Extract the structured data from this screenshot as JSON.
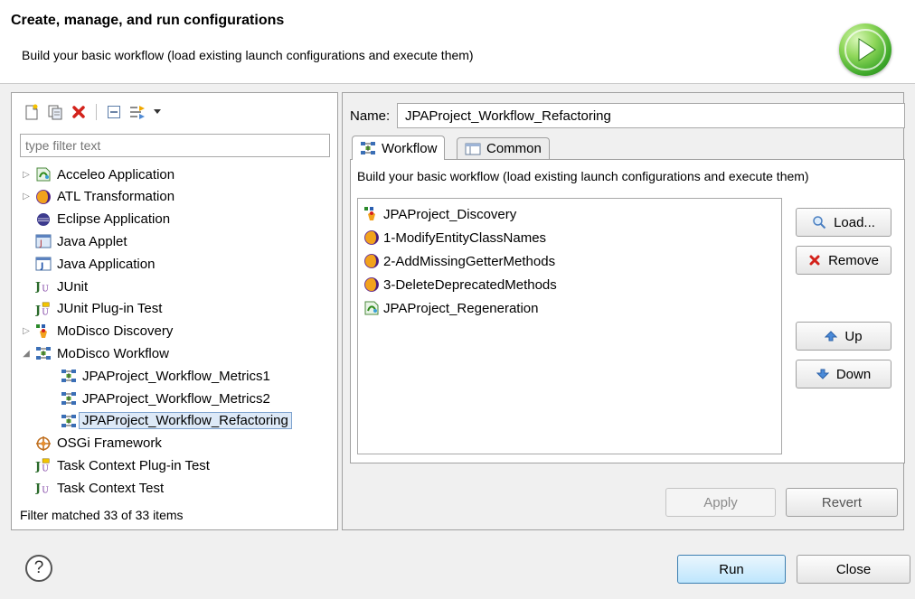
{
  "header": {
    "title": "Create, manage, and run configurations",
    "subtitle": "Build your basic workflow (load existing launch configurations and execute them)"
  },
  "left": {
    "filter_placeholder": "type filter text",
    "tree": [
      {
        "label": "Acceleo Application",
        "icon": "acceleo-icon",
        "expandable": true,
        "expanded": false,
        "level": 0
      },
      {
        "label": "ATL Transformation",
        "icon": "atl-icon",
        "expandable": true,
        "expanded": false,
        "level": 0
      },
      {
        "label": "Eclipse Application",
        "icon": "eclipse-icon",
        "expandable": false,
        "level": 0
      },
      {
        "label": "Java Applet",
        "icon": "java-applet-icon",
        "expandable": false,
        "level": 0
      },
      {
        "label": "Java Application",
        "icon": "java-app-icon",
        "expandable": false,
        "level": 0
      },
      {
        "label": "JUnit",
        "icon": "junit-icon",
        "expandable": false,
        "level": 0
      },
      {
        "label": "JUnit Plug-in Test",
        "icon": "junit-plugin-icon",
        "expandable": false,
        "level": 0
      },
      {
        "label": "MoDisco Discovery",
        "icon": "modisco-discovery-icon",
        "expandable": true,
        "expanded": false,
        "level": 0
      },
      {
        "label": "MoDisco Workflow",
        "icon": "workflow-icon",
        "expandable": true,
        "expanded": true,
        "level": 0
      },
      {
        "label": "JPAProject_Workflow_Metrics1",
        "icon": "workflow-icon",
        "expandable": false,
        "level": 1
      },
      {
        "label": "JPAProject_Workflow_Metrics2",
        "icon": "workflow-icon",
        "expandable": false,
        "level": 1
      },
      {
        "label": "JPAProject_Workflow_Refactoring",
        "icon": "workflow-icon",
        "expandable": false,
        "level": 1,
        "selected": true
      },
      {
        "label": "OSGi Framework",
        "icon": "osgi-icon",
        "expandable": false,
        "level": 0
      },
      {
        "label": "Task Context Plug-in Test",
        "icon": "junit-plugin-icon",
        "expandable": false,
        "level": 0
      },
      {
        "label": "Task Context Test",
        "icon": "junit-icon",
        "expandable": false,
        "level": 0
      }
    ],
    "filter_status": "Filter matched 33 of 33 items"
  },
  "right": {
    "name_label": "Name:",
    "name_value": "JPAProject_Workflow_Refactoring",
    "tabs": [
      {
        "label": "Workflow",
        "icon": "workflow-icon",
        "active": true
      },
      {
        "label": "Common",
        "icon": "common-tab-icon",
        "active": false
      }
    ],
    "tab_description": "Build your basic workflow (load existing launch configurations and execute them)",
    "workflow_items": [
      {
        "label": "JPAProject_Discovery",
        "icon": "modisco-discovery-icon"
      },
      {
        "label": "1-ModifyEntityClassNames",
        "icon": "atl-icon"
      },
      {
        "label": "2-AddMissingGetterMethods",
        "icon": "atl-icon"
      },
      {
        "label": "3-DeleteDeprecatedMethods",
        "icon": "atl-icon"
      },
      {
        "label": "JPAProject_Regeneration",
        "icon": "acceleo-icon"
      }
    ],
    "load_label": "Load...",
    "remove_label": "Remove",
    "up_label": "Up",
    "down_label": "Down",
    "apply_label": "Apply",
    "revert_label": "Revert"
  },
  "footer": {
    "help_symbol": "?",
    "run_label": "Run",
    "close_label": "Close"
  }
}
